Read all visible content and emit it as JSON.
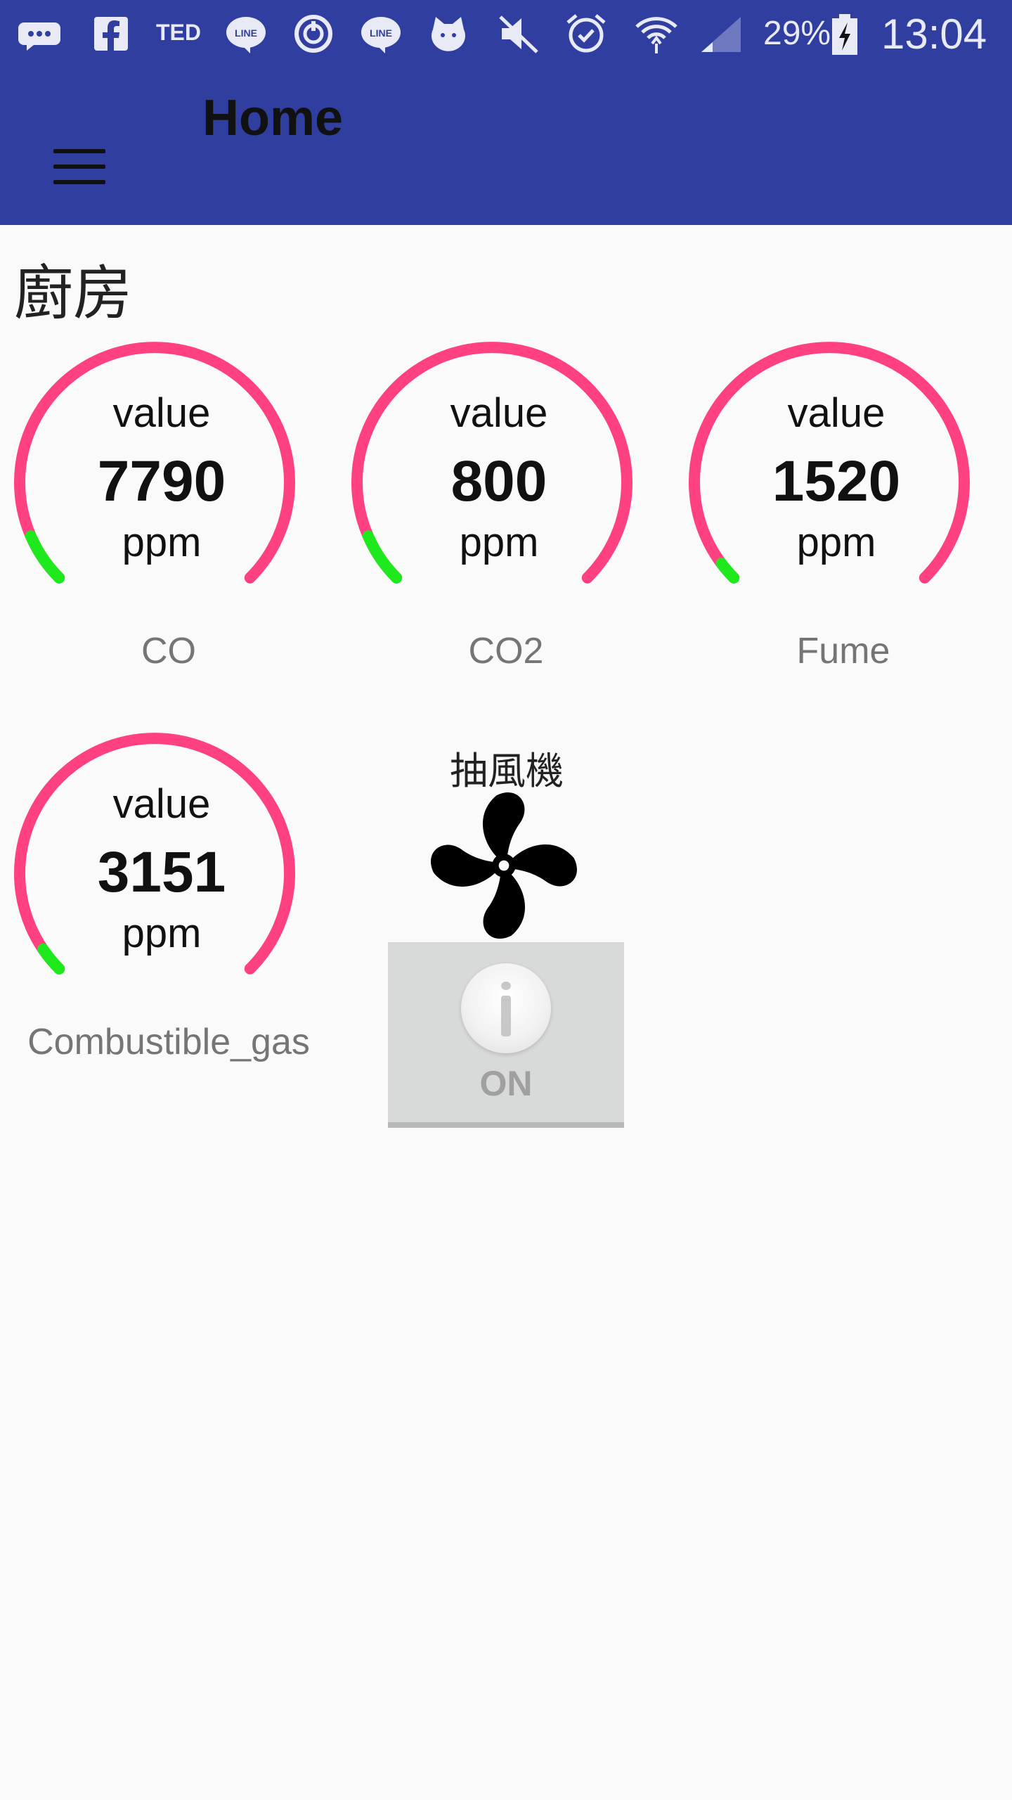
{
  "status_bar": {
    "icons": [
      "message-icon",
      "facebook-icon",
      "ted-icon",
      "line-icon",
      "sync-icon",
      "line-icon",
      "cat-icon",
      "mute-icon",
      "alarm-icon",
      "wifi-icon",
      "signal-icon",
      "battery-icon"
    ],
    "ted_text": "TED",
    "line_text": "LINE",
    "battery": "29%",
    "time": "13:04"
  },
  "app_bar": {
    "title": "Home",
    "color": "#303f9f"
  },
  "section": {
    "title": "廚房"
  },
  "gauges": [
    {
      "label_top": "value",
      "value": "7790",
      "unit": "ppm",
      "caption": "CO",
      "level": 0.08
    },
    {
      "label_top": "value",
      "value": "800",
      "unit": "ppm",
      "caption": "CO2",
      "level": 0.08
    },
    {
      "label_top": "value",
      "value": "1520",
      "unit": "ppm",
      "caption": "Fume",
      "level": 0.03
    },
    {
      "label_top": "value",
      "value": "3151",
      "unit": "ppm",
      "caption": "Combustible_gas",
      "level": 0.04
    }
  ],
  "gauge_colors": {
    "track": "#ff4081",
    "fill": "#1de91d"
  },
  "fan": {
    "label": "抽風機",
    "icon": "fan-icon",
    "toggle_text": "ON"
  }
}
